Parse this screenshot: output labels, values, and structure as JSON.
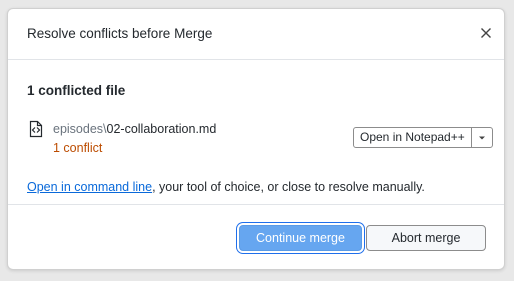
{
  "dialog": {
    "title": "Resolve conflicts before Merge",
    "section_title": "1 conflicted file",
    "file": {
      "directory": "episodes\\",
      "name": "02-collaboration.md",
      "conflict_count": "1 conflict"
    },
    "open_button": {
      "label": "Open in Notepad++"
    },
    "hint": {
      "link_text": "Open in command line",
      "rest_text": ", your tool of choice, or close to resolve manually."
    },
    "buttons": {
      "continue_label": "Continue merge",
      "abort_label": "Abort merge"
    },
    "icons": {
      "close": "close-icon",
      "file": "file-diff-icon",
      "dropdown": "chevron-down-icon"
    },
    "colors": {
      "primary_button": "#66a6f0",
      "link": "#0969da",
      "conflict_text": "#bc4c00"
    }
  }
}
